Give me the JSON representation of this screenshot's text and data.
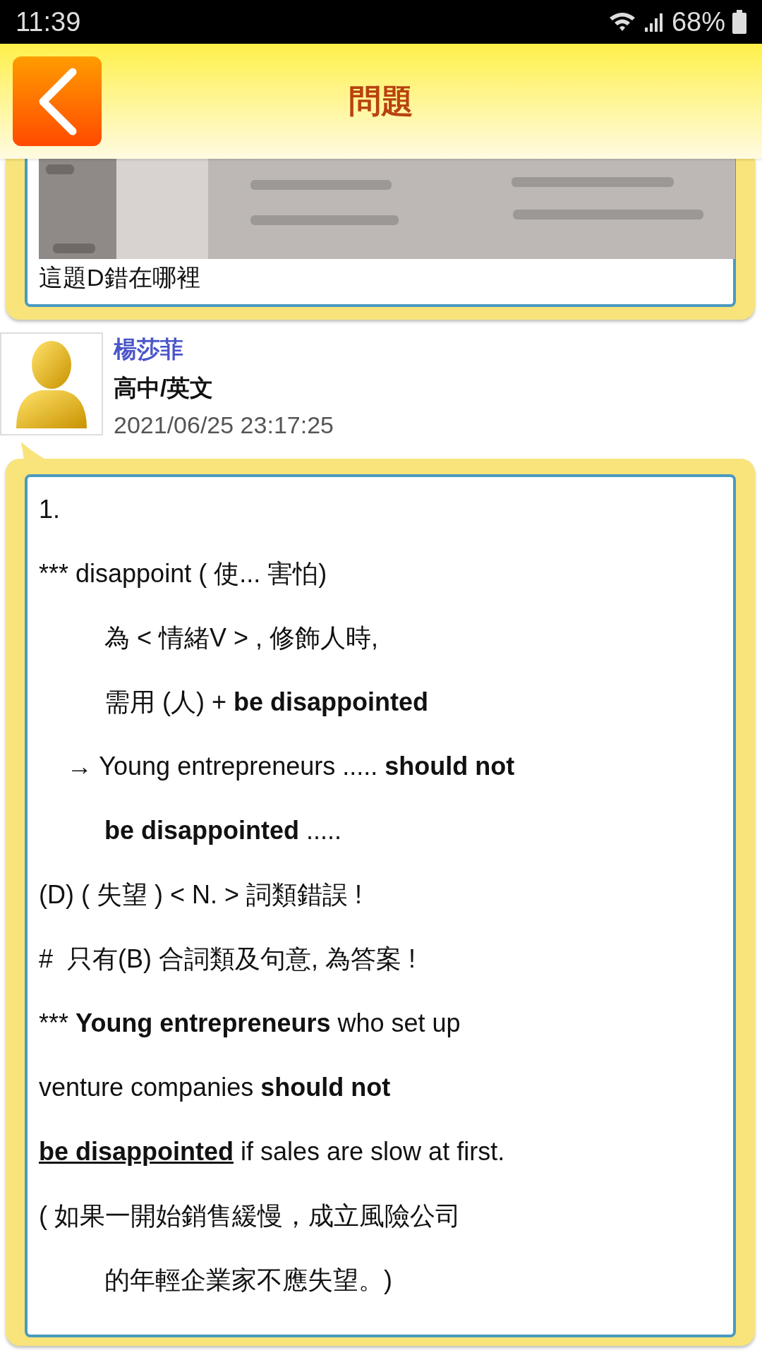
{
  "status_bar": {
    "time": "11:39",
    "battery": "68%"
  },
  "header": {
    "title": "問題"
  },
  "question": {
    "caption": "這題D錯在哪裡"
  },
  "answer": {
    "author": "楊莎菲",
    "subject": "高中/英文",
    "date": "2021/06/25 23:17:25",
    "lines": [
      {
        "kind": "text",
        "text": "1."
      },
      {
        "kind": "text",
        "text": "*** disappoint ( 使... 害怕)"
      },
      {
        "kind": "indented",
        "text": "為 < 情緒V > , 修飾人時,"
      },
      {
        "kind": "indented",
        "text": "需用 (人) + **be disappointed**"
      },
      {
        "kind": "arrow",
        "text": "→ Young entrepreneurs ..... **should not**"
      },
      {
        "kind": "indented",
        "text": "**be disappointed** ....."
      },
      {
        "kind": "text",
        "text": "(D) ( 失望 ) < N. > 詞類錯誤 !"
      },
      {
        "kind": "text",
        "text": "#  只有(B) 合詞類及句意, 為答案 !"
      },
      {
        "kind": "text",
        "marker": "***",
        "text": " **Young entrepreneurs** who set up"
      },
      {
        "kind": "text",
        "text": "venture companies **should not**"
      },
      {
        "kind": "text",
        "underlined": true,
        "text": "**be disappointed** if sales are slow at first."
      },
      {
        "kind": "text",
        "text": "( 如果一開始銷售緩慢，成立風險公司"
      },
      {
        "kind": "indented",
        "text": "的年輕企業家不應失望。)"
      }
    ]
  }
}
